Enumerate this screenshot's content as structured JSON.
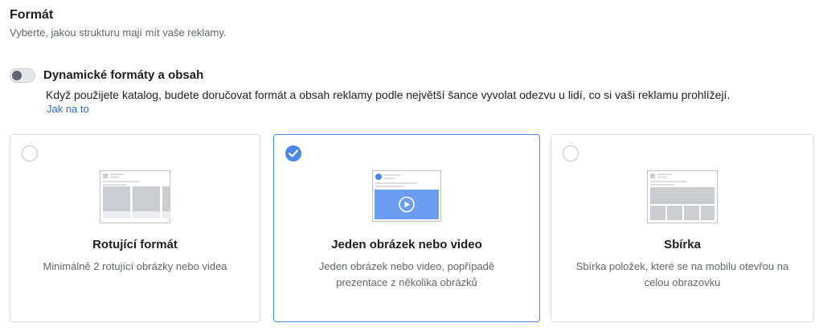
{
  "header": {
    "title": "Formát",
    "subtitle": "Vyberte, jakou strukturu mají mít vaše reklamy."
  },
  "dynamic": {
    "title": "Dynamické formáty a obsah",
    "description": "Když použijete katalog, budete doručovat formát a obsah reklamy podle největší šance vyvolat odezvu u lidí, co si vaši reklamu prohlížejí.",
    "link": "Jak na to",
    "enabled": false
  },
  "formats": [
    {
      "title": "Rotující formát",
      "description": "Minimálně 2 rotující obrázky nebo videa",
      "selected": false,
      "icon": "carousel-icon"
    },
    {
      "title": "Jeden obrázek nebo video",
      "description": "Jeden obrázek nebo video, popřípadě prezentace z několika obrázků",
      "selected": true,
      "icon": "single-video-icon"
    },
    {
      "title": "Sbírka",
      "description": "Sbírka položek, které se na mobilu otevřou na celou obrazovku",
      "selected": false,
      "icon": "collection-icon"
    }
  ],
  "colors": {
    "accent": "#4a86e8",
    "link": "#216fdb"
  }
}
